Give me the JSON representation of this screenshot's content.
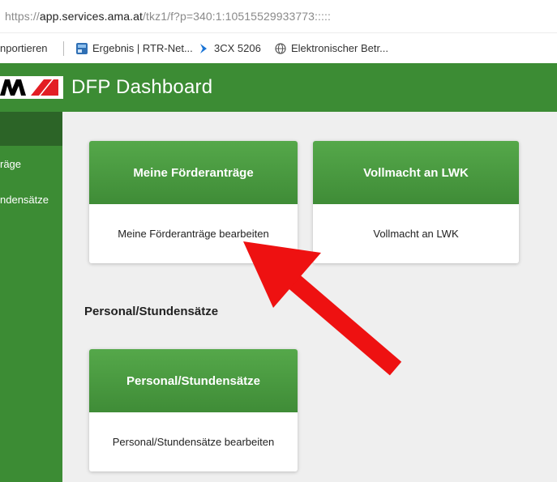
{
  "browser": {
    "url_prefix": "https://",
    "url_domain": "app.services.ama.at",
    "url_path": "/tkz1/f?p=340:1:10515529933773:::::",
    "bookmarks": [
      {
        "label": "nportieren"
      },
      {
        "label": "Ergebnis | RTR-Net..."
      },
      {
        "label": "3CX 5206"
      },
      {
        "label": "Elektronischer Betr..."
      }
    ]
  },
  "app": {
    "title": "DFP Dashboard",
    "brand_color": "#3c8c34",
    "accent_color": "#e31e24"
  },
  "sidebar": {
    "items": [
      {
        "label": "räge"
      },
      {
        "label": "ndensätze"
      }
    ]
  },
  "cards": [
    {
      "title": "Meine Förderanträge",
      "action": "Meine Förderanträge bearbeiten"
    },
    {
      "title": "Vollmacht an LWK",
      "action": "Vollmacht an LWK"
    },
    {
      "title": "Personal/Stundensätze",
      "action": "Personal/Stundensätze bearbeiten"
    }
  ],
  "sections": {
    "personal_title": "Personal/Stundensätze"
  }
}
